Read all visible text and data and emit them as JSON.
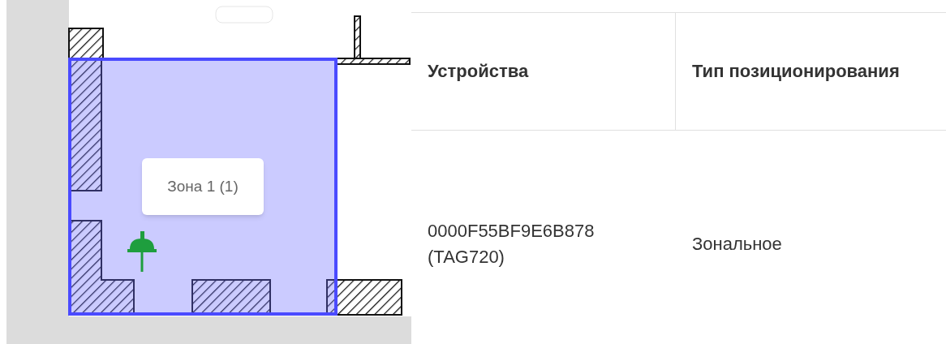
{
  "map": {
    "zone_label": "Зона 1 (1)"
  },
  "table": {
    "columns": [
      "Устройства",
      "Тип позиционирования"
    ],
    "rows": [
      {
        "device": "0000F55BF9E6B878 (TAG720)",
        "positioning": "Зональное"
      }
    ]
  }
}
